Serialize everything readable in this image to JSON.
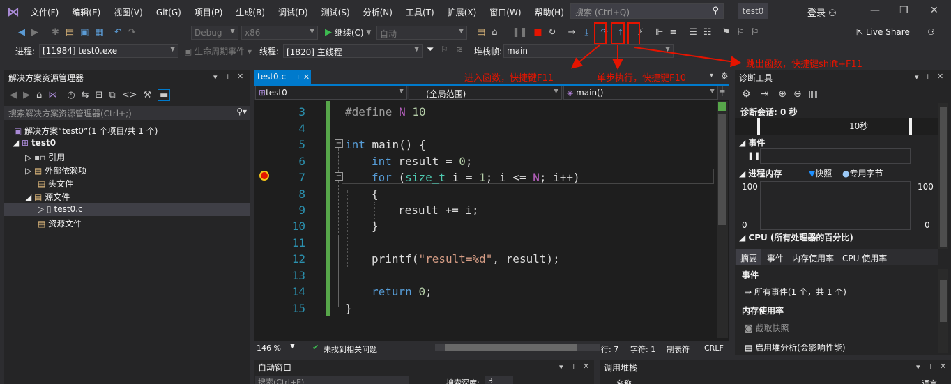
{
  "menu": {
    "items": [
      "文件(F)",
      "编辑(E)",
      "视图(V)",
      "Git(G)",
      "项目(P)",
      "生成(B)",
      "调试(D)",
      "测试(S)",
      "分析(N)",
      "工具(T)",
      "扩展(X)",
      "窗口(W)",
      "帮助(H)"
    ],
    "search_placeholder": "搜索 (Ctrl+Q)",
    "project": "test0",
    "login": "登录"
  },
  "toolbar": {
    "config": "Debug",
    "platform": "x86",
    "continue": "继续(C)",
    "auto": "自动"
  },
  "debugbar": {
    "process_label": "进程:",
    "process": "[11984] test0.exe",
    "lifecycle": "生命周期事件",
    "thread_label": "线程:",
    "thread": "[1820] 主线程",
    "stack_label": "堆栈帧:",
    "stack": "main",
    "live_share": "Live Share"
  },
  "annotations": {
    "step_into": "进入函数，快捷键F11",
    "step_over": "单步执行，快捷键F10",
    "step_out": "跳出函数，快捷键shift+F11"
  },
  "solution": {
    "title": "解决方案资源管理器",
    "search": "搜索解决方案资源管理器(Ctrl+;)",
    "root": "解决方案“test0”(1 个项目/共 1 个)",
    "project": "test0",
    "items": [
      "引用",
      "外部依赖项",
      "头文件",
      "源文件",
      "test0.c",
      "资源文件"
    ]
  },
  "editor": {
    "tab": "test0.c",
    "scope1": "test0",
    "scope2": "(全局范围)",
    "scope3": "main()",
    "zoom": "146 %",
    "issues": "未找到相关问题",
    "row": "行: 7",
    "col": "字符: 1",
    "tab_mode": "制表符",
    "eol": "CRLF",
    "line_numbers": [
      "3",
      "4",
      "5",
      "6",
      "7",
      "8",
      "9",
      "10",
      "11",
      "12",
      "13",
      "14",
      "15"
    ]
  },
  "diag": {
    "title": "诊断工具",
    "session": "诊断会话: 0 秒",
    "tick": "10秒",
    "events": "事件",
    "memory": "进程内存",
    "snapshot": "快照",
    "private": "专用字节",
    "y_max": "100",
    "y_min": "0",
    "cpu": "CPU (所有处理器的百分比)",
    "tabs": [
      "摘要",
      "事件",
      "内存使用率",
      "CPU 使用率"
    ],
    "events_hdr": "事件",
    "all_events": "所有事件(1 个，共 1 个)",
    "mem_hdr": "内存使用率",
    "take_snapshot": "截取快照",
    "heap": "启用堆分析(会影响性能)"
  },
  "bottom": {
    "autos": "自动窗口",
    "autos_search": "搜索(Ctrl+E)",
    "depth": "搜索深度:",
    "depth_val": "3",
    "callstack": "调用堆栈",
    "name": "名称",
    "lang": "语言"
  }
}
